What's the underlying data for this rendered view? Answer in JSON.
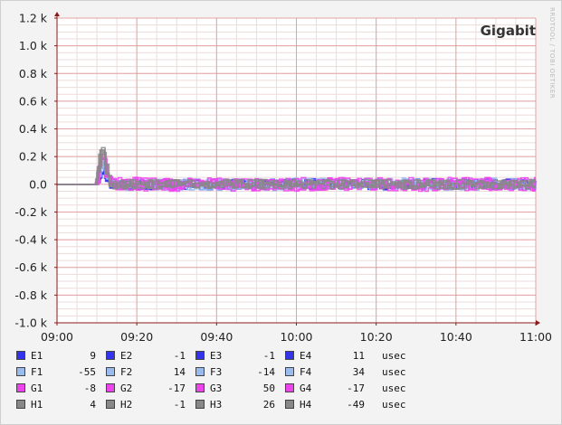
{
  "chart_data": {
    "type": "line",
    "title": "Gigabit",
    "watermark": "RRDTOOL / TOBI OETIKER",
    "xlabel": "",
    "ylabel": "",
    "x_ticks": [
      "09:00",
      "09:20",
      "09:40",
      "10:00",
      "10:20",
      "10:40",
      "11:00"
    ],
    "y_ticks": [
      {
        "v": 1200,
        "label": "1.2 k"
      },
      {
        "v": 1000,
        "label": "1.0 k"
      },
      {
        "v": 800,
        "label": "0.8 k"
      },
      {
        "v": 600,
        "label": "0.6 k"
      },
      {
        "v": 400,
        "label": "0.4 k"
      },
      {
        "v": 200,
        "label": "0.2 k"
      },
      {
        "v": 0,
        "label": "0.0"
      },
      {
        "v": -200,
        "label": "-0.2 k"
      },
      {
        "v": -400,
        "label": "-0.4 k"
      },
      {
        "v": -600,
        "label": "-0.6 k"
      },
      {
        "v": -800,
        "label": "-0.8 k"
      },
      {
        "v": -1000,
        "label": "-1.0 k"
      }
    ],
    "xlim": [
      "09:00",
      "11:00"
    ],
    "ylim": [
      -1000,
      1200
    ],
    "grid": true,
    "legend_position": "bottom",
    "unit": "usec",
    "series": [
      {
        "name": "E1",
        "color": "#3333ee",
        "current": "9",
        "spike": 90,
        "jitter": 40
      },
      {
        "name": "E2",
        "color": "#3333ee",
        "current": "-1",
        "spike": 80,
        "jitter": 35
      },
      {
        "name": "E3",
        "color": "#3333ee",
        "current": "-1",
        "spike": 100,
        "jitter": 35
      },
      {
        "name": "E4",
        "color": "#3333ee",
        "current": "11",
        "spike": 120,
        "jitter": 40
      },
      {
        "name": "F1",
        "color": "#99bbee",
        "current": "-55",
        "spike": 150,
        "jitter": 45
      },
      {
        "name": "F2",
        "color": "#99bbee",
        "current": "14",
        "spike": 170,
        "jitter": 45
      },
      {
        "name": "F3",
        "color": "#99bbee",
        "current": "-14",
        "spike": 190,
        "jitter": 40
      },
      {
        "name": "F4",
        "color": "#99bbee",
        "current": "34",
        "spike": 200,
        "jitter": 40
      },
      {
        "name": "G1",
        "color": "#ee44ee",
        "current": "-8",
        "spike": 210,
        "jitter": 50
      },
      {
        "name": "G2",
        "color": "#ee44ee",
        "current": "-17",
        "spike": 220,
        "jitter": 50
      },
      {
        "name": "G3",
        "color": "#ee44ee",
        "current": "50",
        "spike": 230,
        "jitter": 50
      },
      {
        "name": "G4",
        "color": "#ee44ee",
        "current": "-17",
        "spike": 240,
        "jitter": 45
      },
      {
        "name": "H1",
        "color": "#888888",
        "current": "4",
        "spike": 250,
        "jitter": 35
      },
      {
        "name": "H2",
        "color": "#888888",
        "current": "-1",
        "spike": 270,
        "jitter": 35
      },
      {
        "name": "H3",
        "color": "#888888",
        "current": "26",
        "spike": 300,
        "jitter": 35
      },
      {
        "name": "H4",
        "color": "#888888",
        "current": "-49",
        "spike": 320,
        "jitter": 35
      }
    ]
  }
}
